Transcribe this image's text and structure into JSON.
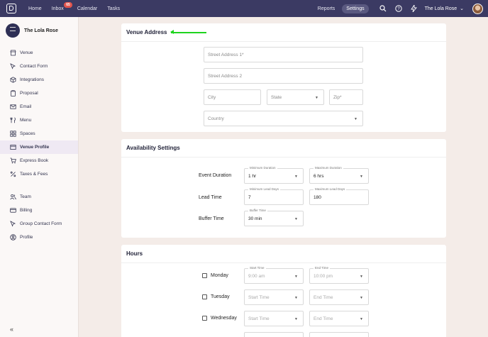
{
  "topbar": {
    "nav": [
      "Home",
      "Inbox",
      "Calendar",
      "Tasks"
    ],
    "inbox_badge": "65",
    "reports": "Reports",
    "settings": "Settings",
    "account": "The Lola Rose"
  },
  "sidebar": {
    "venue_name": "The Lola Rose",
    "items": [
      "Venue",
      "Contact Form",
      "Integrations",
      "Proposal",
      "Email",
      "Menu",
      "Spaces",
      "Venue Profile",
      "Express Book",
      "Taxes & Fees"
    ],
    "items2": [
      "Team",
      "Billing",
      "Group Contact Form",
      "Profile"
    ],
    "active": "Venue Profile",
    "collapse": "«"
  },
  "address": {
    "title": "Venue Address",
    "street1": "Street Address 1*",
    "street2": "Street Address 2",
    "city": "City",
    "state": "State",
    "zip": "Zip*",
    "country": "Country"
  },
  "availability": {
    "title": "Availability Settings",
    "event_duration": "Event Duration",
    "lead_time": "Lead Time",
    "buffer_time": "Buffer Time",
    "min_duration_label": "Minimum Duration",
    "min_duration": "1 hr",
    "max_duration_label": "Maximum Duration",
    "max_duration": "6 hrs",
    "min_lead_label": "Minimum Lead Days",
    "min_lead": "7",
    "max_lead_label": "Maximum Lead Days",
    "max_lead": "180",
    "buffer_label": "Buffer Time",
    "buffer": "30 min"
  },
  "hours": {
    "title": "Hours",
    "days": [
      {
        "day": "Monday",
        "start_label": "Start Time",
        "start": "9:00 am",
        "end_label": "End Time",
        "end": "10:00 pm"
      },
      {
        "day": "Tuesday",
        "start": "Start Time",
        "end": "End Time"
      },
      {
        "day": "Wednesday",
        "start": "Start Time",
        "end": "End Time"
      }
    ]
  }
}
